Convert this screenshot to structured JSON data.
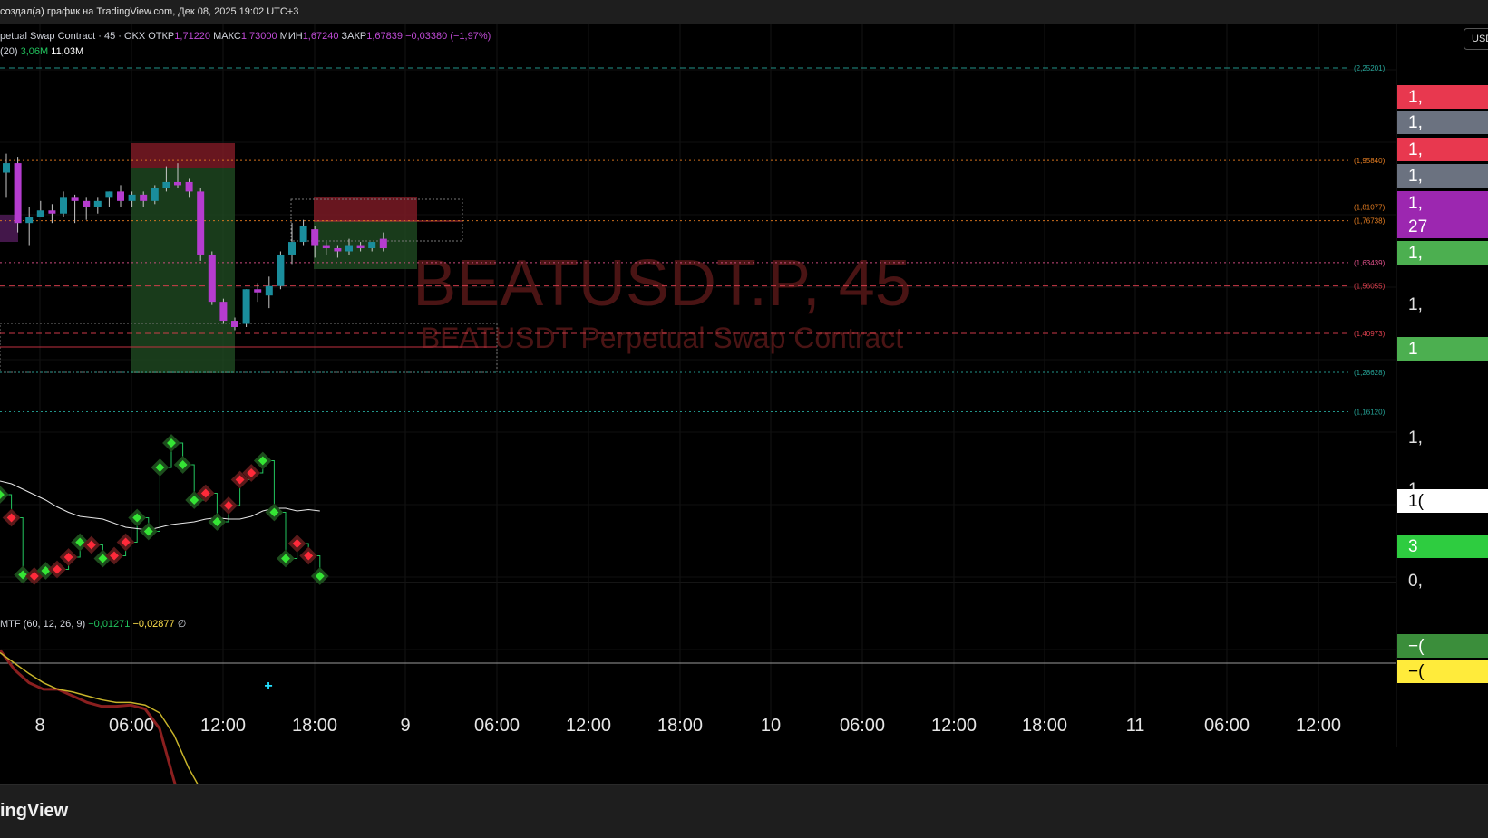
{
  "header": {
    "share_text": "создал(а) график на TradingView.com, Дек 08, 2025 19:02 UTC+3"
  },
  "legend": {
    "symbol": "petual Swap Contract · 45 · OKX",
    "open_label": "ОТКР",
    "open": "1,71220",
    "high_label": "МАКС",
    "high": "1,73000",
    "low_label": "МИН",
    "low": "1,67240",
    "close_label": "ЗАКР",
    "close": "1,67839",
    "change": "−0,03380 (−1,97%)",
    "vol_label": "(20)",
    "vol1": "3,06M",
    "vol2": "11,03M"
  },
  "macd_legend": {
    "name": "MTF (60, 12, 26, 9)",
    "v1": "−0,01271",
    "v2": "−0,02877",
    "v3": "∅"
  },
  "watermark": {
    "title": "BEATUSDT.P, 45",
    "subtitle": "BEATUSDT Perpetual Swap Contract"
  },
  "currency_button": "USD",
  "footer": {
    "brand": "ingView"
  },
  "colors": {
    "up": "#1a8d9c",
    "down": "#b53ccf",
    "bg": "#000000"
  },
  "chart_data": {
    "type": "candlestick",
    "timeframe": "45",
    "x_ticks": [
      "8",
      "06:00",
      "12:00",
      "18:00",
      "9",
      "06:00",
      "12:00",
      "18:00",
      "10",
      "06:00",
      "12:00",
      "18:00",
      "11",
      "06:00",
      "12:00"
    ],
    "candles": [
      {
        "o": 1.92,
        "h": 1.98,
        "l": 1.84,
        "c": 1.95
      },
      {
        "o": 1.95,
        "h": 1.97,
        "l": 1.73,
        "c": 1.76
      },
      {
        "o": 1.76,
        "h": 1.81,
        "l": 1.69,
        "c": 1.78
      },
      {
        "o": 1.78,
        "h": 1.83,
        "l": 1.78,
        "c": 1.8
      },
      {
        "o": 1.8,
        "h": 1.82,
        "l": 1.76,
        "c": 1.79
      },
      {
        "o": 1.79,
        "h": 1.86,
        "l": 1.78,
        "c": 1.84
      },
      {
        "o": 1.84,
        "h": 1.85,
        "l": 1.76,
        "c": 1.83
      },
      {
        "o": 1.83,
        "h": 1.84,
        "l": 1.77,
        "c": 1.81
      },
      {
        "o": 1.81,
        "h": 1.84,
        "l": 1.79,
        "c": 1.83
      },
      {
        "o": 1.84,
        "h": 1.86,
        "l": 1.81,
        "c": 1.86
      },
      {
        "o": 1.86,
        "h": 1.88,
        "l": 1.81,
        "c": 1.83
      },
      {
        "o": 1.83,
        "h": 1.86,
        "l": 1.81,
        "c": 1.85
      },
      {
        "o": 1.85,
        "h": 1.86,
        "l": 1.81,
        "c": 1.83
      },
      {
        "o": 1.83,
        "h": 1.88,
        "l": 1.82,
        "c": 1.87
      },
      {
        "o": 1.87,
        "h": 1.94,
        "l": 1.86,
        "c": 1.89
      },
      {
        "o": 1.89,
        "h": 1.95,
        "l": 1.87,
        "c": 1.88
      },
      {
        "o": 1.89,
        "h": 1.9,
        "l": 1.84,
        "c": 1.86
      },
      {
        "o": 1.86,
        "h": 1.87,
        "l": 1.64,
        "c": 1.66
      },
      {
        "o": 1.66,
        "h": 1.67,
        "l": 1.5,
        "c": 1.51
      },
      {
        "o": 1.51,
        "h": 1.52,
        "l": 1.44,
        "c": 1.45
      },
      {
        "o": 1.45,
        "h": 1.46,
        "l": 1.42,
        "c": 1.43
      },
      {
        "o": 1.44,
        "h": 1.55,
        "l": 1.43,
        "c": 1.55
      },
      {
        "o": 1.55,
        "h": 1.57,
        "l": 1.51,
        "c": 1.54
      },
      {
        "o": 1.53,
        "h": 1.59,
        "l": 1.49,
        "c": 1.56
      },
      {
        "o": 1.56,
        "h": 1.67,
        "l": 1.55,
        "c": 1.66
      },
      {
        "o": 1.66,
        "h": 1.76,
        "l": 1.63,
        "c": 1.7
      },
      {
        "o": 1.7,
        "h": 1.77,
        "l": 1.69,
        "c": 1.75
      },
      {
        "o": 1.74,
        "h": 1.75,
        "l": 1.65,
        "c": 1.69
      },
      {
        "o": 1.69,
        "h": 1.7,
        "l": 1.66,
        "c": 1.68
      },
      {
        "o": 1.68,
        "h": 1.69,
        "l": 1.65,
        "c": 1.67
      },
      {
        "o": 1.67,
        "h": 1.71,
        "l": 1.66,
        "c": 1.69
      },
      {
        "o": 1.69,
        "h": 1.7,
        "l": 1.67,
        "c": 1.68
      },
      {
        "o": 1.68,
        "h": 1.7,
        "l": 1.67,
        "c": 1.7
      },
      {
        "o": 1.71,
        "h": 1.73,
        "l": 1.67,
        "c": 1.68
      }
    ],
    "price_levels": [
      {
        "label": "(2,25201)",
        "value": 2.25201,
        "color": "#26a69a",
        "style": "dashed"
      },
      {
        "label": "(1,95840)",
        "value": 1.9584,
        "color": "#e67e22",
        "style": "dotted"
      },
      {
        "label": "(1,81077)",
        "value": 1.81077,
        "color": "#e67e22",
        "style": "dotted"
      },
      {
        "label": "(1,76738)",
        "value": 1.76738,
        "color": "#e67e22",
        "style": "dotted"
      },
      {
        "label": "(1,63439)",
        "value": 1.63439,
        "color": "#e0508a",
        "style": "dotted"
      },
      {
        "label": "(1,56055)",
        "value": 1.56055,
        "color": "#e0404f",
        "style": "dashed"
      },
      {
        "label": "(1,40973)",
        "value": 1.40973,
        "color": "#e0404f",
        "style": "dashed"
      },
      {
        "label": "(1,28628)",
        "value": 1.28628,
        "color": "#26a69a",
        "style": "dotted"
      },
      {
        "label": "(1,16120)",
        "value": 1.1612,
        "color": "#26a69a",
        "style": "dotted"
      }
    ],
    "right_tags": [
      {
        "text": "1,",
        "bg": "#e8384f",
        "fg": "#ffffff"
      },
      {
        "text": "1,",
        "bg": "#6b7280",
        "fg": "#ffffff"
      },
      {
        "text": "1,",
        "bg": "#e8384f",
        "fg": "#ffffff"
      },
      {
        "text": "1,",
        "bg": "#6b7280",
        "fg": "#ffffff"
      },
      {
        "text": "1,",
        "bg": "#9c27b0",
        "fg": "#ffffff"
      },
      {
        "text": "27",
        "bg": "#9c27b0",
        "fg": "#ffffff"
      },
      {
        "text": "1,",
        "bg": "#4caf50",
        "fg": "#ffffff"
      },
      {
        "text": "1,",
        "bg": "",
        "fg": "#e0e0e0"
      },
      {
        "text": "1",
        "bg": "#4caf50",
        "fg": "#ffffff"
      },
      {
        "text": "1,",
        "bg": "",
        "fg": "#e0e0e0"
      },
      {
        "text": "1,",
        "bg": "",
        "fg": "#e0e0e0"
      },
      {
        "text": "1(",
        "bg": "#ffffff",
        "fg": "#000000"
      },
      {
        "text": "3",
        "bg": "#2ecc40",
        "fg": "#ffffff"
      },
      {
        "text": "0,",
        "bg": "",
        "fg": "#e0e0e0"
      },
      {
        "text": "−(",
        "bg": "#3b8e3b",
        "fg": "#ffffff"
      },
      {
        "text": "−(",
        "bg": "#ffeb3b",
        "fg": "#000000"
      }
    ],
    "osc": {
      "points": [
        {
          "v": 0.62,
          "s": "green"
        },
        {
          "v": 0.45,
          "s": "red"
        },
        {
          "v": 0.03,
          "s": "green"
        },
        {
          "v": 0.02,
          "s": "red"
        },
        {
          "v": 0.06,
          "s": "green"
        },
        {
          "v": 0.07,
          "s": "red"
        },
        {
          "v": 0.16,
          "s": "red"
        },
        {
          "v": 0.27,
          "s": "green"
        },
        {
          "v": 0.25,
          "s": "red"
        },
        {
          "v": 0.15,
          "s": "green"
        },
        {
          "v": 0.17,
          "s": "red"
        },
        {
          "v": 0.27,
          "s": "red"
        },
        {
          "v": 0.45,
          "s": "green"
        },
        {
          "v": 0.35,
          "s": "green"
        },
        {
          "v": 0.82,
          "s": "green"
        },
        {
          "v": 1.0,
          "s": "green"
        },
        {
          "v": 0.84,
          "s": "green"
        },
        {
          "v": 0.58,
          "s": "green"
        },
        {
          "v": 0.63,
          "s": "red"
        },
        {
          "v": 0.42,
          "s": "green"
        },
        {
          "v": 0.54,
          "s": "red"
        },
        {
          "v": 0.73,
          "s": "red"
        },
        {
          "v": 0.78,
          "s": "red"
        },
        {
          "v": 0.87,
          "s": "green"
        },
        {
          "v": 0.49,
          "s": "green"
        },
        {
          "v": 0.15,
          "s": "green"
        },
        {
          "v": 0.26,
          "s": "red"
        },
        {
          "v": 0.17,
          "s": "red"
        },
        {
          "v": 0.02,
          "s": "green"
        }
      ],
      "baseline": [
        0.72,
        0.7,
        0.66,
        0.62,
        0.58,
        0.53,
        0.49,
        0.46,
        0.45,
        0.44,
        0.41,
        0.38,
        0.37,
        0.36,
        0.38,
        0.4,
        0.41,
        0.42,
        0.44,
        0.45,
        0.44,
        0.44,
        0.46,
        0.5,
        0.52,
        0.52,
        0.5,
        0.51,
        0.5
      ]
    },
    "macd": {
      "macd_line": [
        0.01,
        -0.005,
        -0.015,
        -0.02,
        -0.02,
        -0.025,
        -0.03,
        -0.033,
        -0.033,
        -0.032,
        -0.035,
        -0.05,
        -0.09,
        -0.125,
        -0.15,
        -0.16,
        -0.16,
        -0.145,
        -0.125,
        -0.125,
        -0.12,
        -0.112,
        -0.105
      ],
      "signal_line": [
        0.008,
        0.0,
        -0.008,
        -0.015,
        -0.02,
        -0.022,
        -0.025,
        -0.028,
        -0.03,
        -0.03,
        -0.032,
        -0.038,
        -0.055,
        -0.08,
        -0.1,
        -0.12,
        -0.13,
        -0.135,
        -0.13,
        -0.125,
        -0.125,
        -0.12,
        -0.11
      ]
    }
  }
}
